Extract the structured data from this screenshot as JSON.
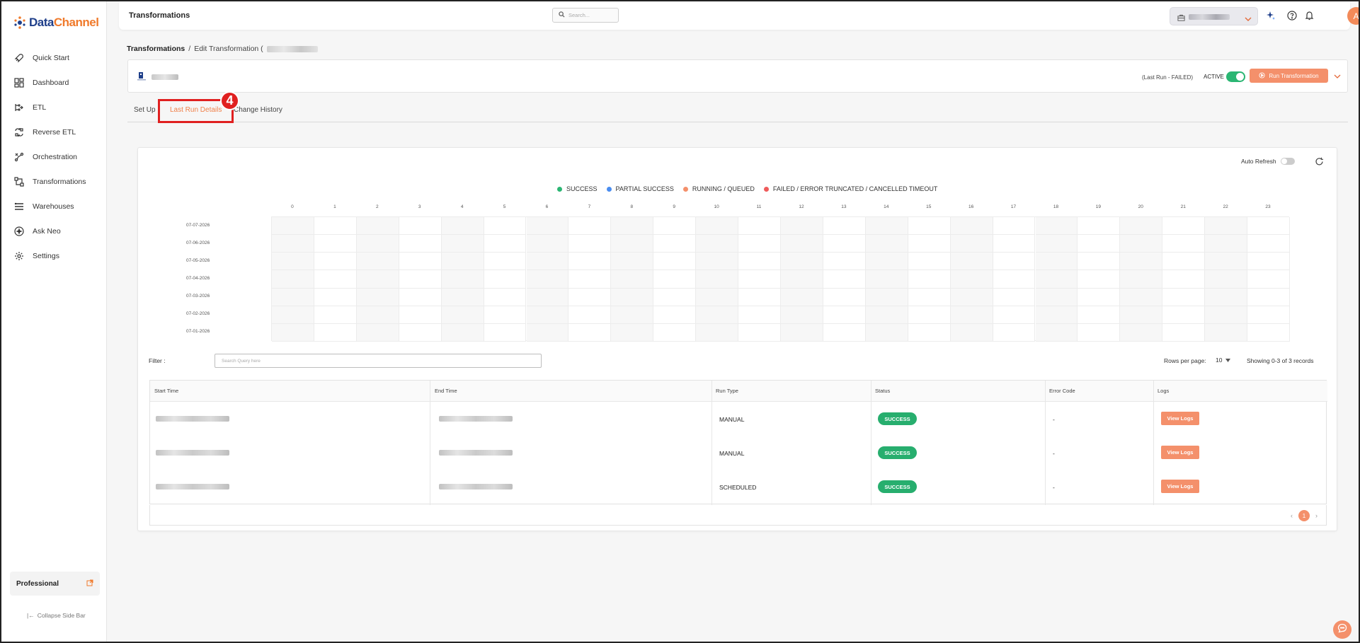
{
  "app": {
    "logo_data": "Data",
    "logo_channel": "Channel"
  },
  "sidebar": {
    "items": [
      {
        "label": "Quick Start",
        "icon": "rocket-icon"
      },
      {
        "label": "Dashboard",
        "icon": "dashboard-icon"
      },
      {
        "label": "ETL",
        "icon": "etl-icon"
      },
      {
        "label": "Reverse ETL",
        "icon": "reverse-etl-icon"
      },
      {
        "label": "Orchestration",
        "icon": "orchestration-icon"
      },
      {
        "label": "Transformations",
        "icon": "transformations-icon"
      },
      {
        "label": "Warehouses",
        "icon": "warehouses-icon"
      },
      {
        "label": "Ask Neo",
        "icon": "ask-neo-icon"
      },
      {
        "label": "Settings",
        "icon": "gear-icon"
      }
    ],
    "plan_label": "Professional",
    "collapse_label": "Collapse Side Bar"
  },
  "header": {
    "title": "Transformations",
    "search_placeholder": "Search...",
    "avatar_initial": "A"
  },
  "breadcrumb": {
    "root": "Transformations",
    "separator": "/",
    "current": "Edit Transformation ("
  },
  "transformation": {
    "last_run": "(Last Run - FAILED)",
    "active_label": "ACTIVE",
    "active": true,
    "run_button": "Run Transformation"
  },
  "tabs": [
    {
      "label": "Set Up",
      "active": false
    },
    {
      "label": "Last Run Details",
      "active": true
    },
    {
      "label": "Change History",
      "active": false
    }
  ],
  "annotation": {
    "step_number": "4"
  },
  "run_details": {
    "auto_refresh_label": "Auto Refresh",
    "auto_refresh_on": false,
    "legend": [
      {
        "label": "SUCCESS",
        "color": "#2bb673"
      },
      {
        "label": "PARTIAL SUCCESS",
        "color": "#4a8df0"
      },
      {
        "label": "RUNNING / QUEUED",
        "color": "#f4906b"
      },
      {
        "label": "FAILED / ERROR TRUNCATED / CANCELLED TIMEOUT",
        "color": "#ef5b5b"
      }
    ],
    "hours": [
      "0",
      "1",
      "2",
      "3",
      "4",
      "5",
      "6",
      "7",
      "8",
      "9",
      "10",
      "11",
      "12",
      "13",
      "14",
      "15",
      "16",
      "17",
      "18",
      "19",
      "20",
      "21",
      "22",
      "23"
    ],
    "days": [
      "07-07-2026",
      "07-06-2026",
      "07-05-2026",
      "07-04-2026",
      "07-03-2026",
      "07-02-2026",
      "07-01-2026"
    ],
    "filter_label": "Filter :",
    "filter_placeholder": "Search Query here",
    "rows_per_page_label": "Rows per page:",
    "rows_per_page_value": "10",
    "showing_text": "Showing 0-3 of 3 records",
    "columns": [
      "Start Time",
      "End Time",
      "Run Type",
      "Status",
      "Error Code",
      "Logs"
    ],
    "rows": [
      {
        "run_type": "MANUAL",
        "status": "SUCCESS",
        "error_code": "-",
        "logs": "View Logs"
      },
      {
        "run_type": "MANUAL",
        "status": "SUCCESS",
        "error_code": "-",
        "logs": "View Logs"
      },
      {
        "run_type": "SCHEDULED",
        "status": "SUCCESS",
        "error_code": "-",
        "logs": "View Logs"
      }
    ],
    "current_page": "1",
    "status_color": "#27ae6e",
    "accent_color": "#f4906b"
  }
}
